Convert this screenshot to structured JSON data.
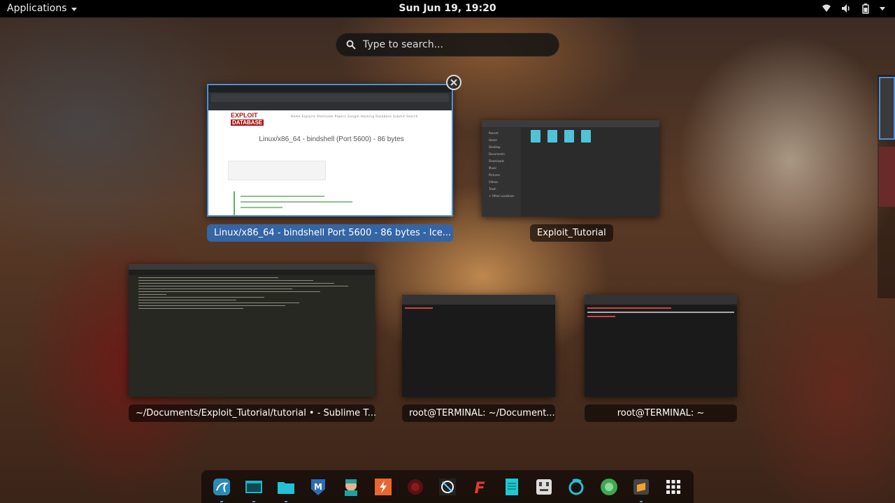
{
  "topbar": {
    "applications_label": "Applications",
    "clock": "Sun Jun 19, 19:20",
    "tray_icons": [
      "wifi-icon",
      "volume-icon",
      "battery-icon",
      "power-menu-caret-icon"
    ]
  },
  "search": {
    "placeholder": "Type to search..."
  },
  "windows": [
    {
      "caption": "Linux/x86_64 - bindshell Port 5600 - 86 bytes - Ice...",
      "selected": true,
      "content": {
        "logo_line1": "EXPLOIT",
        "logo_line2": "DATABASE",
        "nav": "Home    Exploits    Shellcode    Papers    Google Hacking Database    Submit    Search",
        "page_title": "Linux/x86_64 - bindshell (Port 5600) - 86 bytes"
      }
    },
    {
      "caption": "Exploit_Tutorial",
      "selected": false
    },
    {
      "caption": "~/Documents/Exploit_Tutorial/tutorial • - Sublime T...",
      "selected": false
    },
    {
      "caption": "root@TERMINAL: ~/Document...",
      "selected": false
    },
    {
      "caption": "root@TERMINAL: ~",
      "selected": false
    }
  ],
  "files_sidebar": [
    "Recent",
    "Home",
    "Desktop",
    "Documents",
    "Downloads",
    "Music",
    "Pictures",
    "Videos",
    "Trash",
    "+ Other Locations"
  ],
  "dock": {
    "items": [
      "kali-dragon-icon",
      "terminal-icon",
      "files-icon",
      "metasploit-icon",
      "armitage-icon",
      "burpsuite-icon",
      "beef-icon",
      "maltego-icon",
      "faraday-icon",
      "leafpad-icon",
      "cherrytree-icon",
      "reader-icon",
      "hexchat-icon",
      "sublime-icon",
      "show-applications-icon"
    ]
  },
  "colors": {
    "accent": "#4a90d9",
    "selected_caption": "#3465a4"
  }
}
